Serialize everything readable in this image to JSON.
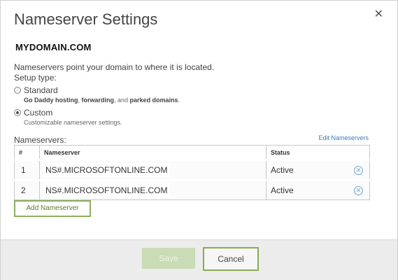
{
  "dialog": {
    "title": "Nameserver Settings",
    "close_glyph": "✕",
    "domain": "MYDOMAIN.COM",
    "intro": "Nameservers point your domain to where it is located.",
    "setup_label": "Setup type:"
  },
  "options": [
    {
      "label": "Standard",
      "checked": false,
      "desc_parts": [
        "Go Daddy hosting",
        ", ",
        "forwarding",
        ", and ",
        "parked domains",
        "."
      ]
    },
    {
      "label": "Custom",
      "checked": true,
      "desc": "Customizable nameserver settings."
    }
  ],
  "nameservers": {
    "label": "Nameservers:",
    "edit_link": "Edit Nameservers",
    "columns": [
      "#",
      "Nameserver",
      "Status"
    ],
    "rows": [
      {
        "num": "1",
        "ns": "NS#.MICROSOFTONLINE.COM",
        "status": "Active",
        "remove_icon": "close-circle-icon"
      },
      {
        "num": "2",
        "ns": "NS#.MICROSOFTONLINE.COM",
        "status": "Active",
        "remove_icon": "close-circle-icon"
      }
    ],
    "add_label": "Add Nameserver"
  },
  "footer": {
    "save_label": "Save",
    "cancel_label": "Cancel"
  },
  "colors": {
    "accent_green": "#86ad4f",
    "link_blue": "#3a7abf",
    "save_disabled": "#c9dcb5"
  }
}
